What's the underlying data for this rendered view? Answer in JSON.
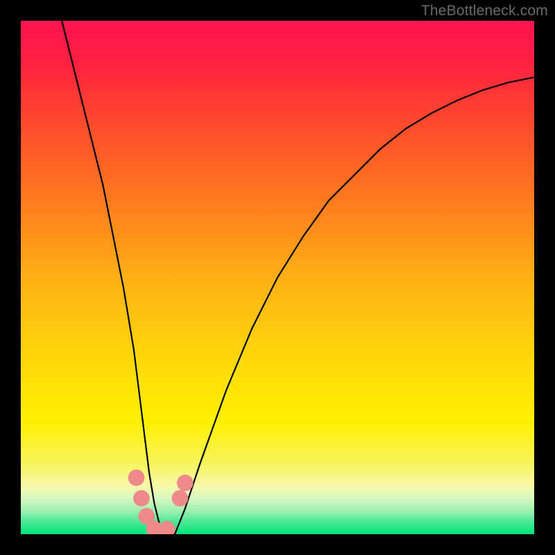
{
  "watermark": "TheBottleneck.com",
  "chart_data": {
    "type": "line",
    "title": "",
    "xlabel": "",
    "ylabel": "",
    "xlim": [
      0,
      100
    ],
    "ylim": [
      0,
      100
    ],
    "grid": false,
    "legend": false,
    "background_gradient_stops": [
      {
        "offset": 0.0,
        "color": "#ff1450"
      },
      {
        "offset": 0.08,
        "color": "#ff2040"
      },
      {
        "offset": 0.2,
        "color": "#ff4a2c"
      },
      {
        "offset": 0.35,
        "color": "#ff7a1e"
      },
      {
        "offset": 0.5,
        "color": "#ffb014"
      },
      {
        "offset": 0.65,
        "color": "#ffd60a"
      },
      {
        "offset": 0.78,
        "color": "#fff000"
      },
      {
        "offset": 0.86,
        "color": "#f5f55a"
      },
      {
        "offset": 0.905,
        "color": "#f8f8a8"
      },
      {
        "offset": 0.93,
        "color": "#d8f8c0"
      },
      {
        "offset": 0.955,
        "color": "#9cf0b0"
      },
      {
        "offset": 0.975,
        "color": "#50e898"
      },
      {
        "offset": 1.0,
        "color": "#00e47a"
      }
    ],
    "series": [
      {
        "name": "bottleneck-curve",
        "color": "#000000",
        "x": [
          8,
          10,
          12,
          14,
          16,
          18,
          20,
          22,
          23,
          24,
          25,
          26,
          27,
          28,
          29,
          30,
          32,
          35,
          40,
          45,
          50,
          55,
          60,
          65,
          70,
          75,
          80,
          85,
          90,
          95,
          100
        ],
        "y": [
          100,
          92,
          84,
          76,
          68,
          58,
          48,
          36,
          28,
          20,
          12,
          6,
          2,
          0,
          0,
          0,
          5,
          14,
          28,
          40,
          50,
          58,
          65,
          70,
          75,
          79,
          82,
          84.5,
          86.5,
          88,
          89
        ]
      }
    ],
    "markers": [
      {
        "name": "marker-1",
        "x": 22.5,
        "y": 11,
        "r": 1.6,
        "color": "#ef8a8a"
      },
      {
        "name": "marker-2",
        "x": 23.5,
        "y": 7,
        "r": 1.6,
        "color": "#ef8a8a"
      },
      {
        "name": "marker-3",
        "x": 24.5,
        "y": 3.5,
        "r": 1.6,
        "color": "#ef8a8a"
      },
      {
        "name": "marker-4",
        "x": 26,
        "y": 1,
        "r": 1.6,
        "color": "#ef8a8a"
      },
      {
        "name": "marker-5",
        "x": 28.5,
        "y": 1,
        "r": 1.6,
        "color": "#ef8a8a"
      },
      {
        "name": "marker-6",
        "x": 31,
        "y": 7,
        "r": 1.6,
        "color": "#ef8a8a"
      },
      {
        "name": "marker-7",
        "x": 32,
        "y": 10,
        "r": 1.6,
        "color": "#ef8a8a"
      }
    ]
  }
}
